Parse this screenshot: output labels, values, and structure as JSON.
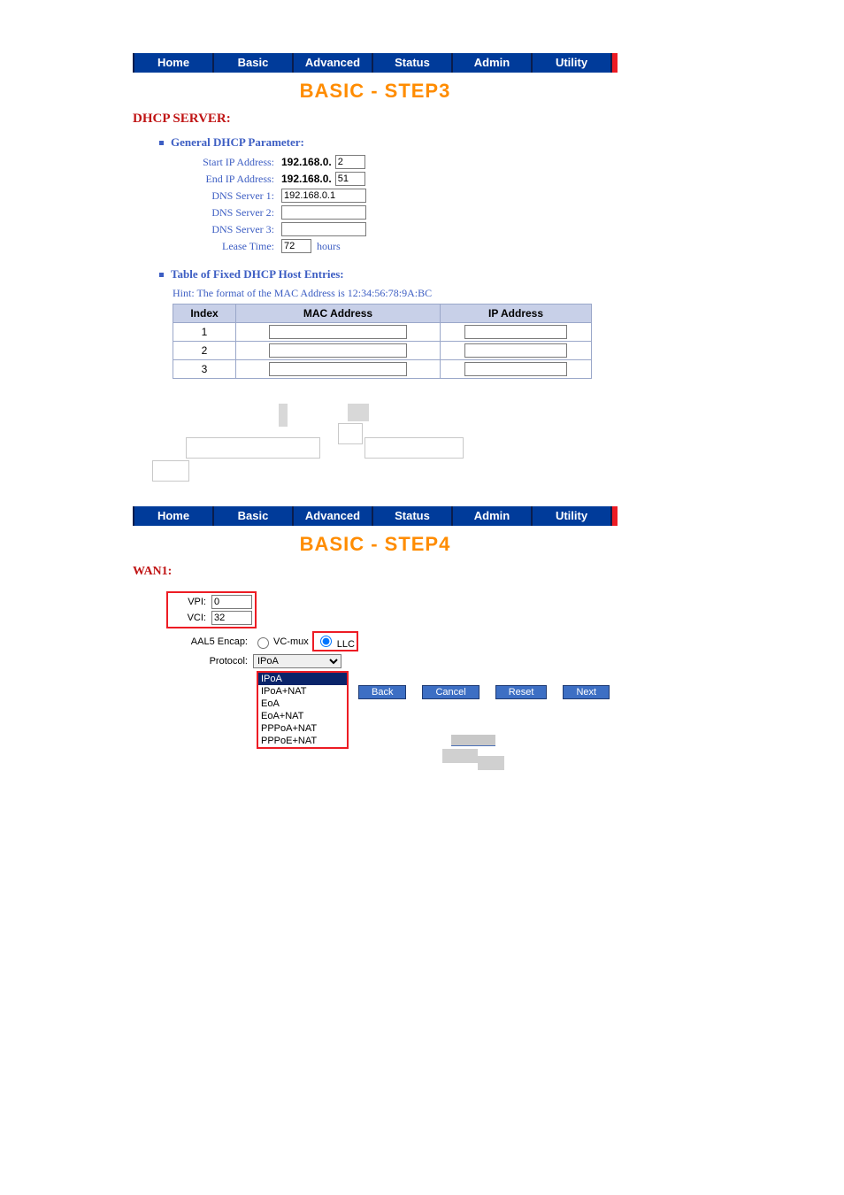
{
  "nav": {
    "items": [
      "Home",
      "Basic",
      "Advanced",
      "Status",
      "Admin",
      "Utility"
    ]
  },
  "step3": {
    "title": "BASIC - STEP3",
    "section": "DHCP SERVER:",
    "general_heading": "General DHCP Parameter:",
    "rows": {
      "start_ip_label": "Start IP Address:",
      "start_ip_prefix": "192.168.0.",
      "start_ip_value": "2",
      "end_ip_label": "End IP Address:",
      "end_ip_prefix": "192.168.0.",
      "end_ip_value": "51",
      "dns1_label": "DNS Server 1:",
      "dns1_value": "192.168.0.1",
      "dns2_label": "DNS Server 2:",
      "dns2_value": "",
      "dns3_label": "DNS Server 3:",
      "dns3_value": "",
      "lease_label": "Lease Time:",
      "lease_value": "72",
      "lease_unit": "hours"
    },
    "fixed_heading": "Table of Fixed DHCP Host Entries:",
    "hint": "Hint: The format of the MAC Address is 12:34:56:78:9A:BC",
    "table": {
      "h_index": "Index",
      "h_mac": "MAC Address",
      "h_ip": "IP Address",
      "rows": [
        {
          "idx": "1",
          "mac": "",
          "ip": ""
        },
        {
          "idx": "2",
          "mac": "",
          "ip": ""
        },
        {
          "idx": "3",
          "mac": "",
          "ip": ""
        }
      ]
    }
  },
  "step4": {
    "title": "BASIC - STEP4",
    "wan_label": "WAN1:",
    "vpi_label": "VPI:",
    "vpi_value": "0",
    "vci_label": "VCI:",
    "vci_value": "32",
    "aal5_label": "AAL5 Encap:",
    "aal5_opt1": "VC-mux",
    "aal5_opt2": "LLC",
    "protocol_label": "Protocol:",
    "protocol_value": "IPoA",
    "protocol_options": [
      "IPoA",
      "IPoA+NAT",
      "EoA",
      "EoA+NAT",
      "PPPoA+NAT",
      "PPPoE+NAT"
    ],
    "buttons": {
      "back": "Back",
      "cancel": "Cancel",
      "reset": "Reset",
      "next": "Next"
    }
  }
}
